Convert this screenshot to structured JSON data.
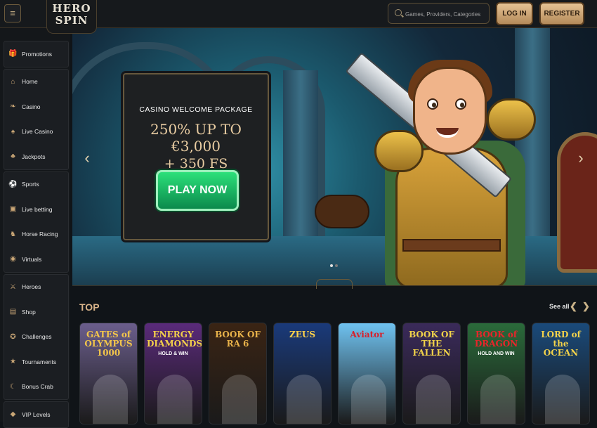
{
  "header": {
    "logo_line1": "HERO",
    "logo_line2": "SPIN",
    "search_placeholder": "Games, Providers, Categories",
    "login_label": "LOG IN",
    "register_label": "REGISTER"
  },
  "sidebar": {
    "groups": [
      [
        {
          "label": "Promotions",
          "icon": "gift-icon"
        }
      ],
      [
        {
          "label": "Home",
          "icon": "home-icon"
        },
        {
          "label": "Casino",
          "icon": "cherries-icon"
        },
        {
          "label": "Live Casino",
          "icon": "cards-icon"
        },
        {
          "label": "Jackpots",
          "icon": "clover-icon"
        }
      ],
      [
        {
          "label": "Sports",
          "icon": "soccer-ball-icon"
        },
        {
          "label": "Live betting",
          "icon": "live-scoreboard-icon"
        },
        {
          "label": "Horse Racing",
          "icon": "horse-icon"
        },
        {
          "label": "Virtuals",
          "icon": "gamepad-icon"
        }
      ],
      [
        {
          "label": "Heroes",
          "icon": "swords-icon"
        },
        {
          "label": "Shop",
          "icon": "shopping-bag-icon"
        },
        {
          "label": "Challenges",
          "icon": "medal-icon"
        },
        {
          "label": "Tournaments",
          "icon": "trophy-icon"
        },
        {
          "label": "Bonus Crab",
          "icon": "crab-claw-icon"
        }
      ],
      [
        {
          "label": "VIP Levels",
          "icon": "diamond-icon"
        }
      ]
    ]
  },
  "banner": {
    "package_label": "CASINO WELCOME PACKAGE",
    "offer_line1": "250% UP TO €3,000",
    "offer_line2": "+ 350 FS",
    "cta_label": "PLAY NOW",
    "prev_arrow": "‹",
    "next_arrow": "›"
  },
  "top_section": {
    "title": "TOP",
    "see_all_label": "See all",
    "games": [
      {
        "title": "GATES of OLYMPUS 1000",
        "subtitle": "",
        "bg": "#6b5e8c",
        "fg": "#f3c64a"
      },
      {
        "title": "ENERGY DIAMONDS",
        "subtitle": "HOLD & WIN",
        "bg": "#5a2a7a",
        "fg": "#f3d04a"
      },
      {
        "title": "BOOK OF RA 6",
        "subtitle": "",
        "bg": "#3a2414",
        "fg": "#e8b24a"
      },
      {
        "title": "ZEUS",
        "subtitle": "",
        "bg": "#1a3a7a",
        "fg": "#ffd24a"
      },
      {
        "title": "Aviator",
        "subtitle": "",
        "bg": "#6fc2f0",
        "fg": "#d8202a"
      },
      {
        "title": "BOOK OF THE FALLEN",
        "subtitle": "",
        "bg": "#3a2a5a",
        "fg": "#f0d24a"
      },
      {
        "title": "BOOK of DRAGON",
        "subtitle": "HOLD AND WIN",
        "bg": "#2a6a3a",
        "fg": "#e8242a"
      },
      {
        "title": "LORD of the OCEAN",
        "subtitle": "",
        "bg": "#1a4a7a",
        "fg": "#f3d24a"
      }
    ]
  }
}
